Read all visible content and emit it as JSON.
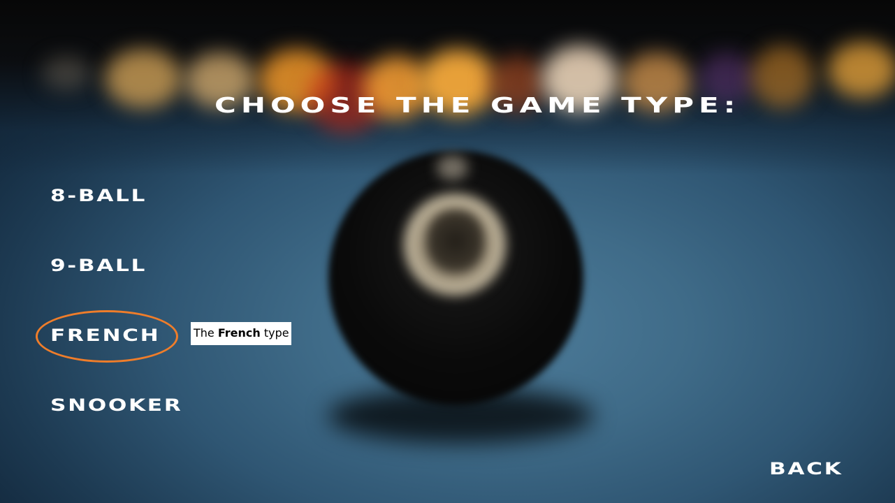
{
  "title": "CHOOSE THE GAME TYPE:",
  "menu": {
    "items": [
      {
        "label": "8-BALL"
      },
      {
        "label": "9-BALL"
      },
      {
        "label": "FRENCH"
      },
      {
        "label": "SNOOKER"
      }
    ],
    "selected": "FRENCH"
  },
  "tooltip": {
    "prefix": "The",
    "emphasis": "French",
    "suffix": "type"
  },
  "back_label": "BACK",
  "colors": {
    "text": "#ffffff",
    "highlight_ring": "#ef7d2a",
    "tooltip_bg": "#ffffff",
    "tooltip_text": "#000000",
    "table_felt": "#3f6b88"
  },
  "background": {
    "description_icon": "blurred-eight-ball-on-pool-table"
  }
}
